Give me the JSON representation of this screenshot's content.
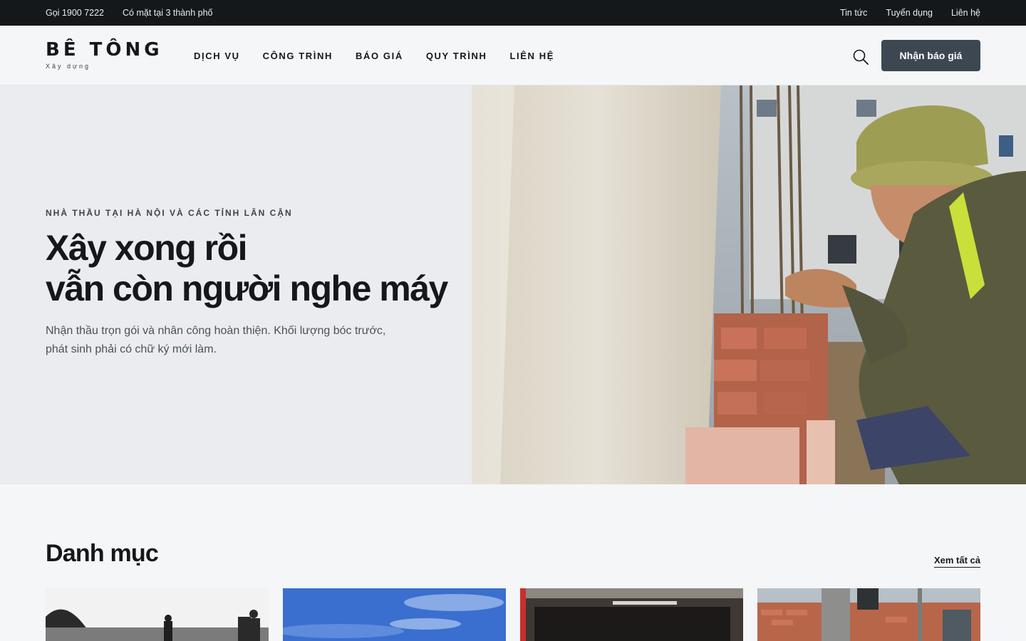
{
  "topbar": {
    "phone": "Gọi 1900 7222",
    "cities": "Có mặt tại 3 thành phố",
    "links": [
      "Tin tức",
      "Tuyển dụng",
      "Liên hệ"
    ]
  },
  "header": {
    "logo_name": "BÊ TÔNG",
    "logo_tag": "Xây dựng",
    "nav": [
      "DỊCH VỤ",
      "CÔNG TRÌNH",
      "BÁO GIÁ",
      "QUY TRÌNH",
      "LIÊN HỆ"
    ],
    "search_icon": "search-icon",
    "cta_label": "Nhận báo giá"
  },
  "hero": {
    "eyebrow": "NHÀ THẦU TẠI HÀ NỘI VÀ CÁC TỈNH LÂN CẬN",
    "headline_line1": "Xây xong rồi",
    "headline_line2": "vẫn còn người nghe máy",
    "lede_line1": "Nhận thầu trọn gói và nhân công hoàn thiện. Khối lượng bóc trước,",
    "lede_line2": "phát sinh phải có chữ ký mới làm.",
    "image": "construction-worker-laying-bricks-photo"
  },
  "categories": {
    "title": "Danh mục",
    "view_all": "Xem tất cả",
    "cards": [
      {
        "image": "workers-on-site-bw-photo"
      },
      {
        "image": "blue-sky-photo"
      },
      {
        "image": "building-interior-photo"
      },
      {
        "image": "brick-wall-construction-photo"
      }
    ]
  },
  "colors": {
    "topbar_bg": "#15181b",
    "cta_bg": "#3d4751",
    "hero_left_bg": "#eaecef",
    "page_bg": "#f4f6f8"
  }
}
